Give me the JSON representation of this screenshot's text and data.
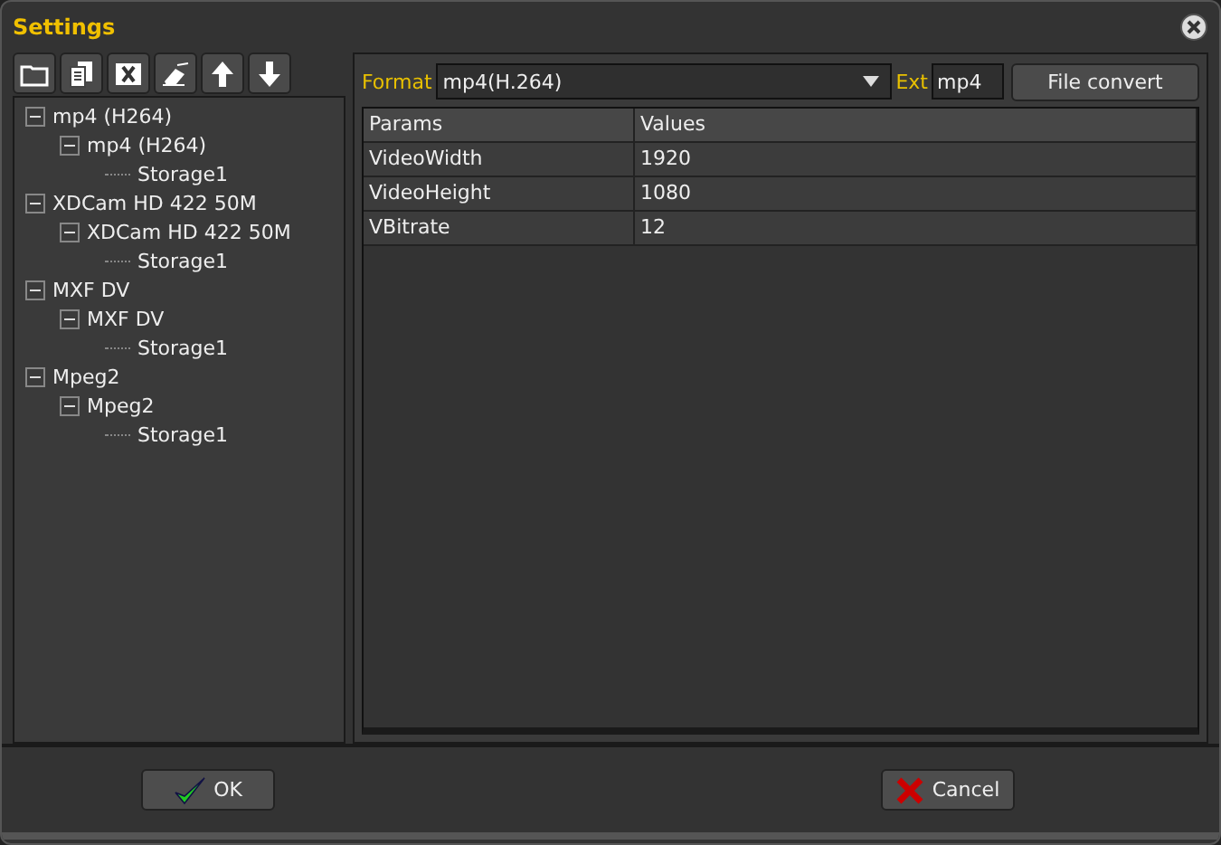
{
  "window": {
    "title": "Settings"
  },
  "tree": [
    {
      "label": "mp4 (H264)",
      "expanded": true,
      "children": [
        {
          "label": "mp4 (H264)",
          "expanded": true,
          "children": [
            {
              "label": "Storage1"
            }
          ]
        }
      ]
    },
    {
      "label": "XDCam HD 422 50M",
      "expanded": true,
      "children": [
        {
          "label": "XDCam HD 422 50M",
          "expanded": true,
          "children": [
            {
              "label": "Storage1"
            }
          ]
        }
      ]
    },
    {
      "label": "MXF DV",
      "expanded": true,
      "children": [
        {
          "label": "MXF DV",
          "expanded": true,
          "children": [
            {
              "label": "Storage1"
            }
          ]
        }
      ]
    },
    {
      "label": "Mpeg2",
      "expanded": true,
      "children": [
        {
          "label": "Mpeg2",
          "expanded": true,
          "children": [
            {
              "label": "Storage1"
            }
          ]
        }
      ]
    }
  ],
  "format": {
    "label": "Format",
    "value": "mp4(H.264)"
  },
  "ext": {
    "label": "Ext",
    "value": "mp4"
  },
  "convert_button": "File convert",
  "table": {
    "columns": [
      "Params",
      "Values"
    ],
    "rows": [
      [
        "VideoWidth",
        "1920"
      ],
      [
        "VideoHeight",
        "1080"
      ],
      [
        "VBitrate",
        "12"
      ]
    ]
  },
  "buttons": [
    {
      "kind": "ok",
      "label": "OK"
    },
    {
      "kind": "cancel",
      "label": "Cancel"
    }
  ]
}
